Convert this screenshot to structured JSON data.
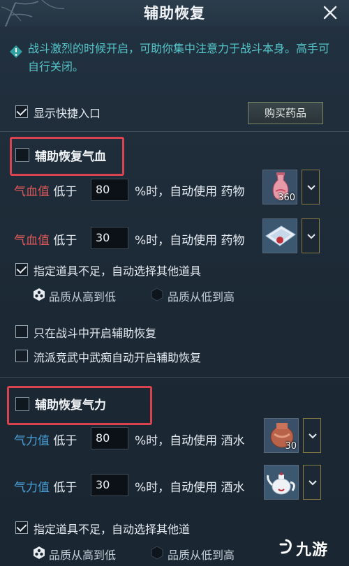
{
  "window": {
    "title": "辅助恢复"
  },
  "tip": {
    "text": "战斗激烈的时候开启，可助你集中注意力于战斗本身。高手可自行关闭。"
  },
  "shortcut": {
    "label": "显示快捷入口",
    "checked": true
  },
  "buy_button": {
    "label": "购买药品"
  },
  "hp_section": {
    "title": "辅助恢复气血",
    "enabled": false,
    "rows": [
      {
        "stat": "气血值",
        "below": "低于",
        "value": "80",
        "suffix": "%时，自动使用 药物",
        "item_qty": "360",
        "item_icon": "red-potion-vase-icon"
      },
      {
        "stat": "气血值",
        "below": "低于",
        "value": "30",
        "suffix": "%时，自动使用 药物",
        "item_qty": "",
        "item_icon": "white-medicine-pack-icon"
      }
    ],
    "fallback_label": "指定道具不足，自动选择其他道具",
    "fallback_checked": true,
    "quality_high_to_low": "品质从高到低",
    "quality_low_to_high": "品质从低到高",
    "selected_quality": "high_to_low",
    "only_in_battle": "只在战斗中开启辅助恢复",
    "only_in_battle_checked": false,
    "pvp_auto": "流派竞武中武痴自动开启辅助恢复",
    "pvp_auto_checked": false
  },
  "mp_section": {
    "title": "辅助恢复气力",
    "enabled": false,
    "rows": [
      {
        "stat": "气力值",
        "below": "低于",
        "value": "80",
        "suffix": "%时，自动使用 酒水",
        "item_qty": "30",
        "item_icon": "wine-jar-icon"
      },
      {
        "stat": "气力值",
        "below": "低于",
        "value": "30",
        "suffix": "%时，自动使用 酒水",
        "item_qty": "",
        "item_icon": "teapot-icon"
      }
    ],
    "fallback_label": "指定道具不足，自动选择其他道",
    "fallback_checked": true,
    "quality_high_to_low": "品质从高到低",
    "quality_low_to_high": "品质从低到高"
  },
  "watermark": {
    "text": "九游"
  },
  "colors": {
    "hp_label": "#e15a5a",
    "mp_label": "#4aa0d8",
    "tip_text": "#53c6c9",
    "highlight": "#d9434f"
  }
}
